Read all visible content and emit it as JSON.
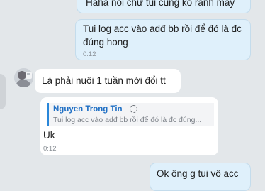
{
  "messages": {
    "top": {
      "text": "Haha nói chứ tui cũng ko rảnh mấy"
    },
    "outgoing_1": {
      "line1": "Tui log acc vào adđ bb rồi để đó là đc",
      "line2": "đúng hong",
      "time": "0:12"
    },
    "incoming_1": {
      "text": "Là phải nuôi 1 tuần mới đổi tt"
    },
    "incoming_reply": {
      "quote_name": "Nguyen Trong Tin",
      "quote_text": "Tui log acc vào adđ bb rồi để đó là đc đúng...",
      "text": "Uk",
      "time": "0:12"
    },
    "outgoing_2": {
      "text": "Ok ông g tui vô acc"
    }
  }
}
